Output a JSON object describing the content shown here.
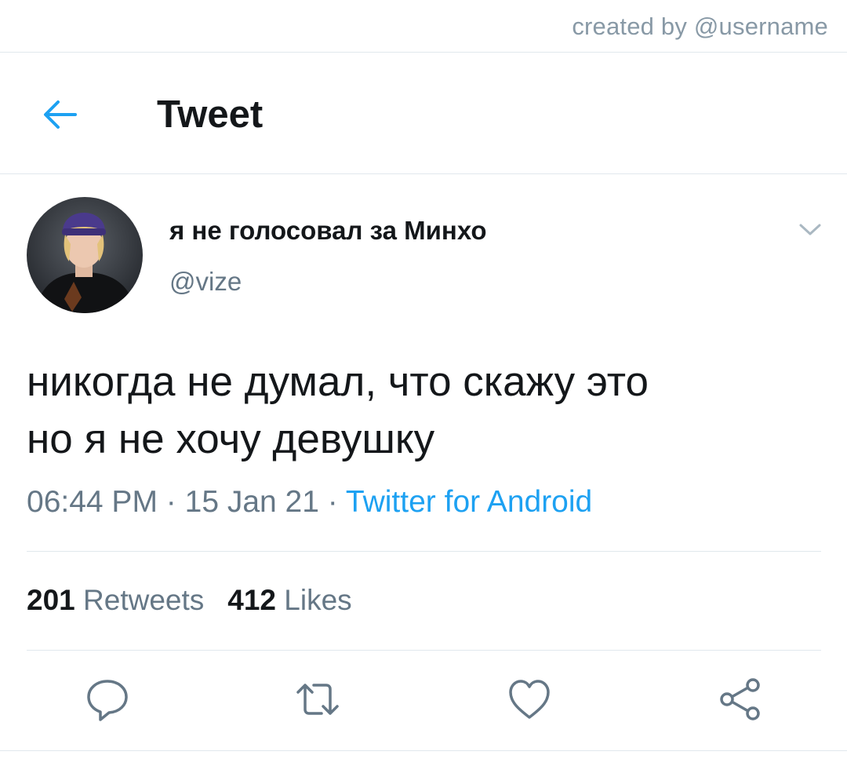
{
  "watermark": "created by @username",
  "header": {
    "title": "Tweet",
    "back_icon": "arrow-left-icon"
  },
  "user": {
    "display_name": "я не голосовал за Минхо",
    "handle": "@vize"
  },
  "tweet": {
    "lines": [
      "никогда не думал, что скажу это",
      "но я не хочу девушку"
    ],
    "time": "06:44 PM",
    "date": "15 Jan 21",
    "source": "Twitter for Android",
    "dot": "·"
  },
  "stats": {
    "retweets_count": "201",
    "retweets_label": "Retweets",
    "likes_count": "412",
    "likes_label": "Likes"
  },
  "actions": [
    "reply-icon",
    "retweet-icon",
    "like-icon",
    "share-icon"
  ],
  "colors": {
    "accent": "#1da1f2",
    "secondary_text": "#657786",
    "primary_text": "#14171a",
    "divider": "#e1e8ed"
  }
}
